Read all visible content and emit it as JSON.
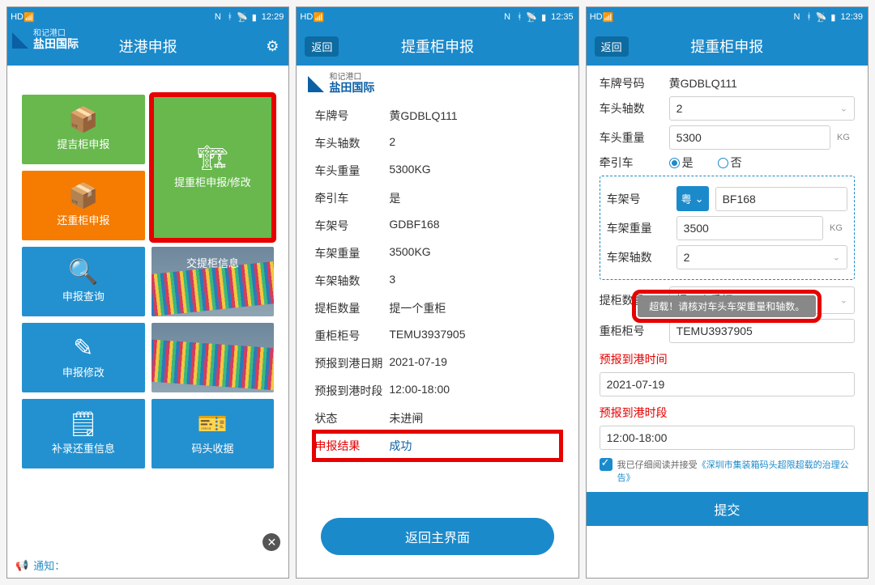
{
  "status": {
    "hd_badge": "HD",
    "signal_label": "信号",
    "battery_pct": "78",
    "nfc": "N",
    "bt": "B",
    "volte": "VoLTE",
    "times": {
      "s1": "12:29",
      "s2": "12:35",
      "s3": "12:39"
    }
  },
  "screen1": {
    "title": "进港申报",
    "logo_small": "和记港口",
    "logo_big": "盐田国际",
    "tiles": {
      "t1": "提吉柜申报",
      "t2": "提重柜申报/修改",
      "t3": "还重柜申报",
      "t4": "申报查询",
      "t5": "交提柜信息",
      "t6": "申报修改",
      "t7": "补录还重信息",
      "t8": "码头收据"
    },
    "notify_label": "通知："
  },
  "screen2": {
    "back": "返回",
    "title": "提重柜申报",
    "rows": {
      "plate_k": "车牌号",
      "plate_v": "黄GDBLQ111",
      "axles_k": "车头轴数",
      "axles_v": "2",
      "headwt_k": "车头重量",
      "headwt_v": "5300KG",
      "tractor_k": "牵引车",
      "tractor_v": "是",
      "chassis_k": "车架号",
      "chassis_v": "GDBF168",
      "chassiswt_k": "车架重量",
      "chassiswt_v": "3500KG",
      "chassisax_k": "车架轴数",
      "chassisax_v": "3",
      "qty_k": "提柜数量",
      "qty_v": "提一个重柜",
      "cntr_k": "重柜柜号",
      "cntr_v": "TEMU3937905",
      "eta_d_k": "预报到港日期",
      "eta_d_v": "2021-07-19",
      "eta_t_k": "预报到港时段",
      "eta_t_v": "12:00-18:00",
      "state_k": "状态",
      "state_v": "未进闸",
      "result_k": "申报结果",
      "result_v": "成功"
    },
    "home_btn": "返回主界面"
  },
  "screen3": {
    "back": "返回",
    "title": "提重柜申报",
    "labels": {
      "plate": "车牌号码",
      "plate_v": "黄GDBLQ111",
      "axles": "车头轴数",
      "axles_v": "2",
      "headwt": "车头重量",
      "headwt_v": "5300",
      "kg": "KG",
      "tractor": "牵引车",
      "yes": "是",
      "no": "否",
      "chassis": "车架号",
      "province": "粤",
      "chassis_v": "BF168",
      "chassiswt": "车架重量",
      "chassiswt_v": "3500",
      "chassisax": "车架轴数",
      "chassisax_v": "2",
      "qty": "提柜数量",
      "qty_v": "提一个重柜",
      "cntr": "重柜柜号",
      "cntr_v": "TEMU3937905",
      "eta_time_hdr": "预报到港时间",
      "eta_time_v": "2021-07-19",
      "eta_slot_hdr": "预报到港时段",
      "eta_slot_v": "12:00-18:00"
    },
    "warn": "超载！请核对车头车架重量和轴数。",
    "consent_pre": "我已仔细阅读并接受",
    "consent_link": "《深圳市集装箱码头超限超载的治理公告》",
    "submit": "提交"
  }
}
